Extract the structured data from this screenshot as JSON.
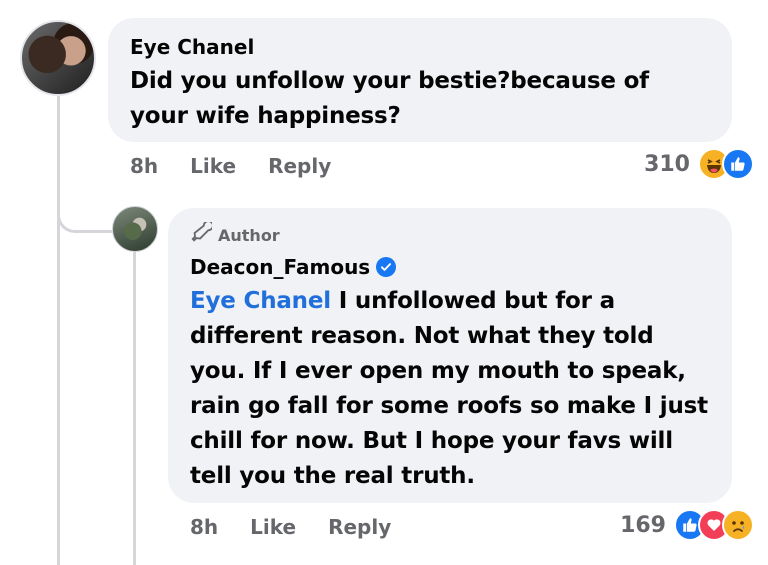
{
  "comment": {
    "author_name": "Eye Chanel",
    "text": "Did you unfollow your bestie?because of your wife happiness?",
    "time": "8h",
    "like_label": "Like",
    "reply_label": "Reply",
    "reaction_count": "310",
    "reactions": [
      "laugh-reaction-icon",
      "like-reaction-icon"
    ]
  },
  "reply": {
    "badge": "Author",
    "author_name": "Deacon_Famous",
    "mention": "Eye Chanel",
    "text": " I unfollowed but for a different reason. Not what they told you. If I ever open my mouth to speak, rain go fall for some roofs so make I just chill for now. But I hope your favs will tell you the real truth.",
    "time": "8h",
    "like_label": "Like",
    "reply_label": "Reply",
    "reaction_count": "169",
    "reactions": [
      "like-reaction-icon",
      "love-reaction-icon",
      "sad-reaction-icon"
    ]
  },
  "colors": {
    "bubble": "#f0f2f5",
    "mention": "#216fdb",
    "verified": "#1877f2",
    "meta": "#65676b"
  }
}
